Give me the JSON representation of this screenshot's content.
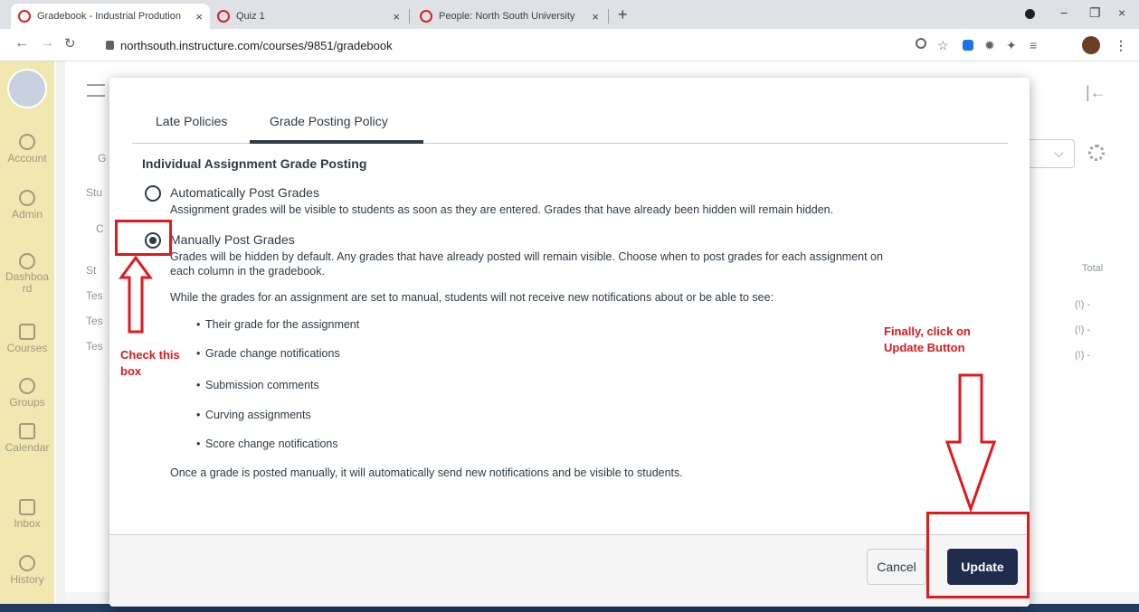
{
  "browser": {
    "tabs": [
      {
        "title": "Gradebook - Industrial Prodution",
        "close": "×"
      },
      {
        "title": "Quiz 1",
        "close": "×"
      },
      {
        "title": "People: North South University",
        "close": "×"
      }
    ],
    "new_tab": "+",
    "url": "northsouth.instructure.com/courses/9851/gradebook",
    "window_controls": {
      "minimize": "−",
      "maximize": "❐",
      "close": "×"
    }
  },
  "global_nav": {
    "items": [
      {
        "label": "Account",
        "icon": "account-icon"
      },
      {
        "label": "Admin",
        "icon": "admin-icon"
      },
      {
        "label": "Dashboard",
        "icon": "dashboard-icon"
      },
      {
        "label": "Courses",
        "icon": "courses-icon"
      },
      {
        "label": "Groups",
        "icon": "groups-icon"
      },
      {
        "label": "Calendar",
        "icon": "calendar-icon"
      },
      {
        "label": "Inbox",
        "icon": "inbox-icon"
      },
      {
        "label": "History",
        "icon": "history-icon"
      }
    ]
  },
  "background": {
    "total_header": "Total",
    "total_cells": [
      "(!) -",
      "(!) -",
      "(!) -"
    ],
    "row_labels": [
      "Tes",
      "Tes",
      "Tes"
    ],
    "fragments": {
      "g": "G",
      "stu": "Stu",
      "c": "C",
      "st": "St"
    }
  },
  "modal": {
    "tabs": [
      {
        "label": "Late Policies",
        "active": false
      },
      {
        "label": "Grade Posting Policy",
        "active": true
      }
    ],
    "section_title": "Individual Assignment Grade Posting",
    "options": [
      {
        "label": "Automatically Post Grades",
        "description": "Assignment grades will be visible to students as soon as they are entered. Grades that have already been hidden will remain hidden.",
        "selected": false
      },
      {
        "label": "Manually Post Grades",
        "description_line1": "Grades will be hidden by default. Any grades that have already posted will remain visible. Choose when to post grades for each assignment on",
        "description_line2": "each column in the gradebook.",
        "selected": true
      }
    ],
    "manual_note": "While the grades for an assignment are set to manual, students will not receive new notifications about or be able to see:",
    "bullets": [
      "Their grade for the assignment",
      "Grade change notifications",
      "Submission comments",
      "Curving assignments",
      "Score change notifications"
    ],
    "closing_note": "Once a grade is posted manually, it will automatically send new notifications and be visible to students.",
    "buttons": {
      "cancel": "Cancel",
      "update": "Update"
    }
  },
  "annotations": {
    "check_box_line1": "Check this",
    "check_box_line2": "box",
    "finally_line1": "Finally, click on",
    "finally_line2": "Update Button",
    "color": "#e0191d"
  },
  "colors": {
    "update_button": "#1f2c4d",
    "global_nav": "#f1e7b0",
    "annotation": "#e0191d"
  }
}
